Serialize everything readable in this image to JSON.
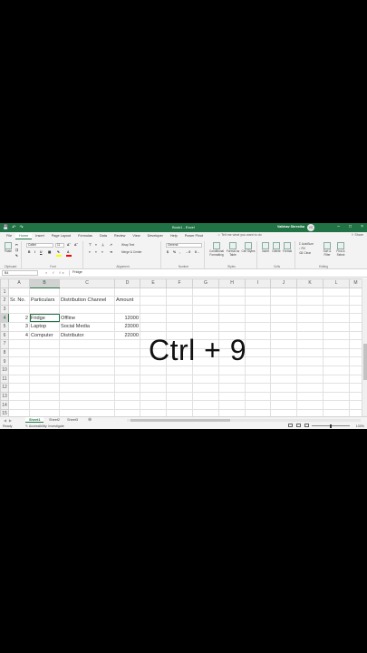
{
  "app": {
    "title": "Book1 - Excel",
    "user": "Vaibhav Shrestha",
    "initials": "VS",
    "accent": "#217346"
  },
  "tabs": [
    "File",
    "Home",
    "Insert",
    "Page Layout",
    "Formulas",
    "Data",
    "Review",
    "View",
    "Developer",
    "Help",
    "Power Pivot"
  ],
  "active_tab": "Home",
  "tell_me": "Tell me what you want to do",
  "share": "Share",
  "ribbon": {
    "clipboard": {
      "label": "Clipboard",
      "paste": "Paste"
    },
    "font": {
      "label": "Font",
      "name": "Calibri",
      "size": "11"
    },
    "alignment": {
      "label": "Alignment",
      "wrap": "Wrap Text",
      "merge": "Merge & Center"
    },
    "number": {
      "label": "Number",
      "format": "General"
    },
    "styles": {
      "label": "Styles",
      "conditional": "Conditional Formatting",
      "format_table": "Format as Table",
      "cell_styles": "Cell Styles"
    },
    "cells": {
      "label": "Cells",
      "insert": "Insert",
      "delete": "Delete",
      "format": "Format"
    },
    "editing": {
      "label": "Editing",
      "autosum": "AutoSum",
      "fill": "Fill",
      "clear": "Clear",
      "sort": "Sort & Filter",
      "find": "Find & Select"
    }
  },
  "formula_bar": {
    "name_box": "B4",
    "fx": "fx",
    "content": "Fridge"
  },
  "columns": [
    "A",
    "B",
    "C",
    "D",
    "E",
    "F",
    "G",
    "H",
    "I",
    "J",
    "K",
    "L",
    "M"
  ],
  "rows": [
    {
      "n": "1",
      "cells": [
        "",
        "",
        "",
        ""
      ]
    },
    {
      "n": "2",
      "cells": [
        "Sr. No.",
        "Particulars",
        "Distribution Channel",
        "Amount"
      ]
    },
    {
      "n": "3",
      "cells": [
        "",
        "",
        "",
        ""
      ]
    },
    {
      "n": "4",
      "cells": [
        "2",
        "Fridge",
        "Offline",
        "12000"
      ]
    },
    {
      "n": "5",
      "cells": [
        "3",
        "Laptop",
        "Social Media",
        "23000"
      ]
    },
    {
      "n": "6",
      "cells": [
        "4",
        "Computer",
        "Distributor",
        "22000"
      ]
    },
    {
      "n": "7",
      "cells": [
        "",
        "",
        "",
        ""
      ]
    },
    {
      "n": "8",
      "cells": [
        "",
        "",
        "",
        ""
      ]
    },
    {
      "n": "9",
      "cells": [
        "",
        "",
        "",
        ""
      ]
    },
    {
      "n": "10",
      "cells": [
        "",
        "",
        "",
        ""
      ]
    },
    {
      "n": "11",
      "cells": [
        "",
        "",
        "",
        ""
      ]
    },
    {
      "n": "12",
      "cells": [
        "",
        "",
        "",
        ""
      ]
    },
    {
      "n": "13",
      "cells": [
        "",
        "",
        "",
        ""
      ]
    },
    {
      "n": "14",
      "cells": [
        "",
        "",
        "",
        ""
      ]
    },
    {
      "n": "15",
      "cells": [
        "",
        "",
        "",
        ""
      ]
    },
    {
      "n": "16",
      "cells": [
        "",
        "",
        "",
        ""
      ]
    }
  ],
  "overlay_text": "Ctrl + 9",
  "sheets": [
    "Sheet1",
    "Sheet2",
    "Sheet3"
  ],
  "active_sheet": "Sheet1",
  "status": {
    "ready": "Ready",
    "accessibility": "Accessibility: Investigate",
    "zoom": "100%"
  }
}
